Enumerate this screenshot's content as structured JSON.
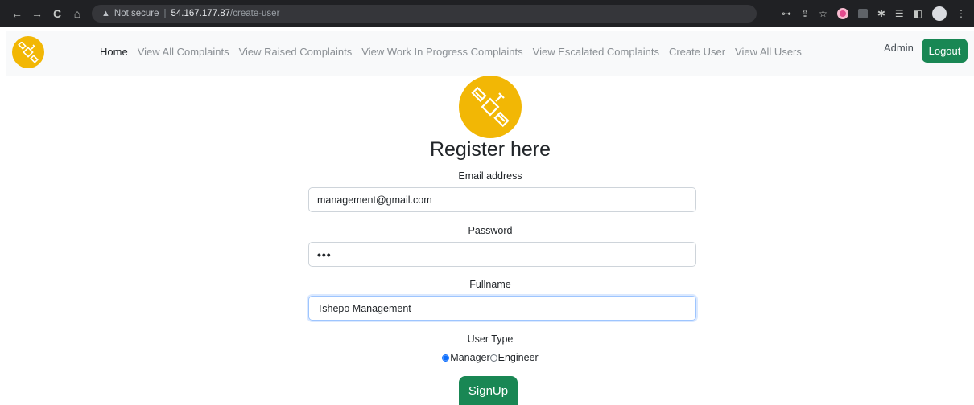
{
  "browser": {
    "back_icon": "←",
    "forward_icon": "→",
    "reload_icon": "C",
    "home_icon": "⌂",
    "security_icon": "▲",
    "security_label": "Not secure",
    "url_host": "54.167.177.87",
    "url_path": "/create-user",
    "icons": [
      "key-icon",
      "share-icon",
      "star-icon",
      "extension-icon",
      "puzzle-icon",
      "tab-search-icon",
      "sidebar-icon",
      "profile-icon",
      "menu-icon"
    ],
    "key_icon": "⊶",
    "share_icon": "⇪",
    "star_icon": "☆",
    "puzzle_icon": "✱",
    "reading_icon": "☰",
    "sidebar_icon": "◧",
    "menu_icon": "⋮"
  },
  "navbar": {
    "links": [
      {
        "label": "Home"
      },
      {
        "label": "View All Complaints"
      },
      {
        "label": "View Raised Complaints"
      },
      {
        "label": "View Work In Progress Complaints"
      },
      {
        "label": "View Escalated Complaints"
      },
      {
        "label": "Create User"
      },
      {
        "label": "View All Users"
      }
    ],
    "user_label": "Admin",
    "logout_label": "Logout"
  },
  "form": {
    "title": "Register here",
    "email_label": "Email address",
    "email_value": "management@gmail.com",
    "password_label": "Password",
    "password_value": "•••",
    "fullname_label": "Fullname",
    "fullname_value": "Tshepo Management",
    "user_type_label": "User Type",
    "options": [
      {
        "label": "Manager",
        "selected": true
      },
      {
        "label": "Engineer",
        "selected": false
      }
    ],
    "submit_label": "SignUp"
  },
  "colors": {
    "brand_yellow": "#f2b705",
    "success_green": "#198754",
    "focus_blue": "#9ec5fe"
  }
}
